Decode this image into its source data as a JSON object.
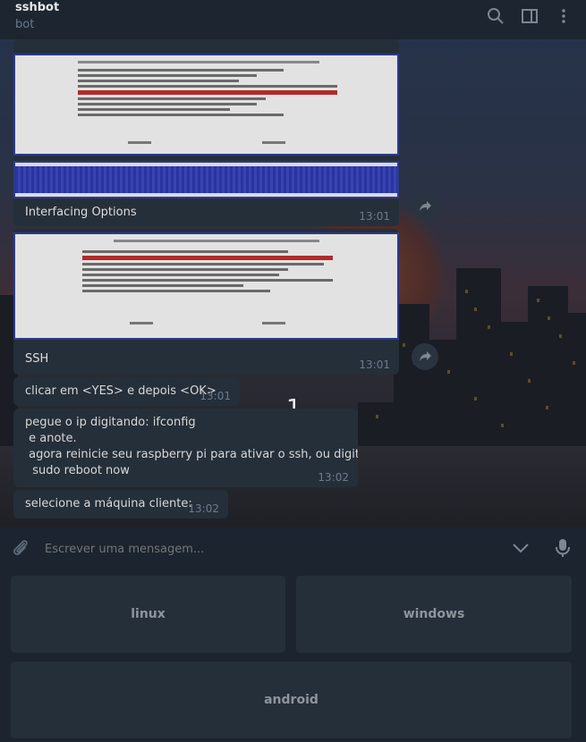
{
  "header": {
    "title": "sshbot",
    "subtitle": "bot",
    "icons": [
      "search-icon",
      "sidebar-panel-icon",
      "more-vertical-icon"
    ]
  },
  "messages": {
    "image1": {
      "caption": "Interfacing Options",
      "time": "13:01"
    },
    "image2": {
      "caption": "SSH",
      "time": "13:01"
    },
    "msg1": {
      "text": "clicar em <YES> e depois <OK>",
      "time": "13:01"
    },
    "msg2": {
      "text": "pegue o ip digitando: ifconfig\n e anote.\n agora reinicie seu raspberry pi para ativar o ssh, ou digite :\n  sudo reboot now",
      "time": "13:02"
    },
    "msg3": {
      "text": "selecione a máquina cliente:",
      "time": "13:02"
    }
  },
  "overlay": {
    "page_number": "1"
  },
  "composer": {
    "placeholder": "Escrever uma mensagem..."
  },
  "keyboard": {
    "buttons": [
      {
        "label": "linux"
      },
      {
        "label": "windows"
      },
      {
        "label": "android"
      }
    ]
  },
  "colors": {
    "background": "#17212b",
    "bubble": "#252f3a",
    "time": "#6b7b8b",
    "terminal_blue": "#2a34a0",
    "terminal_highlight": "#b22a2a"
  }
}
